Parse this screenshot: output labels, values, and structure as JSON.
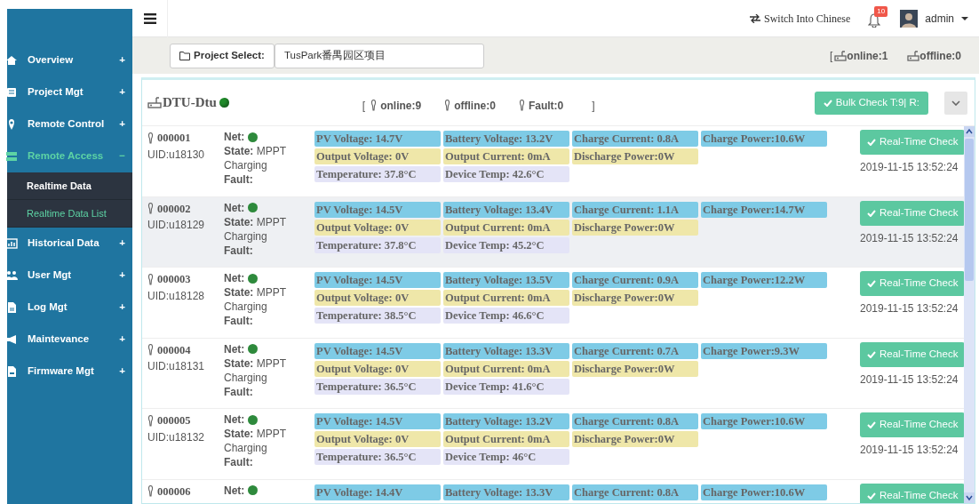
{
  "topbar": {
    "language_link": "Switch Into Chinese",
    "notification_count": "10",
    "user": "admin"
  },
  "sidebar": {
    "items": [
      {
        "label": "Overview",
        "sign": "+",
        "expanded": false
      },
      {
        "label": "Project Mgt",
        "sign": "+",
        "expanded": false
      },
      {
        "label": "Remote Control",
        "sign": "+",
        "expanded": false
      },
      {
        "label": "Remote Access",
        "sign": "−",
        "expanded": true,
        "children": [
          {
            "label": "Realtime Data",
            "selected": false
          },
          {
            "label": "Realtime Data List",
            "selected": true
          }
        ]
      },
      {
        "label": "Historical Data",
        "sign": "+",
        "expanded": false
      },
      {
        "label": "User Mgt",
        "sign": "+",
        "expanded": false
      },
      {
        "label": "Log Mgt",
        "sign": "+",
        "expanded": false
      },
      {
        "label": "Maintevance",
        "sign": "+",
        "expanded": false
      },
      {
        "label": "Firmware Mgt",
        "sign": "+",
        "expanded": false
      }
    ]
  },
  "project_bar": {
    "button": "Project Select:",
    "value": "TusPark番禺园区项目",
    "open_bracket": "[",
    "online": "online:1",
    "offline": "offline:0"
  },
  "panel": {
    "title": "DTU-Dtu",
    "online": true,
    "open_bracket": "[",
    "online_count": "online:9",
    "offline_count": "offline:0",
    "fault_count": "Fault:0",
    "close_bracket": "]",
    "bulk_button": "Bulk Check T:9| R:"
  },
  "devices": [
    {
      "id": "000001",
      "uid": "UID:u18130",
      "net_label": "Net:",
      "online": true,
      "state_label": "State:",
      "state": "MPPT Charging",
      "fault_label": "Fault:",
      "highlighted": false,
      "lines": [
        [
          {
            "kind": "input",
            "text": "PV Voltage: 14.7V"
          },
          {
            "kind": "input",
            "text": "Battery Voltage: 13.2V"
          },
          {
            "kind": "input",
            "text": "Charge Current: 0.8A"
          },
          {
            "kind": "input",
            "text": "Charge Power:10.6W"
          }
        ],
        [
          {
            "kind": "output",
            "text": "Output Voltage: 0V"
          },
          {
            "kind": "output",
            "text": "Output Current: 0mA"
          },
          {
            "kind": "output",
            "text": "Discharge Power:0W"
          }
        ],
        [
          {
            "kind": "temp",
            "text": "Temperature: 37.8°C"
          },
          {
            "kind": "temp",
            "text": "Device Temp: 42.6°C"
          }
        ]
      ],
      "button": "Real-Time Check",
      "time": "2019-11-15 13:52:24"
    },
    {
      "id": "000002",
      "uid": "UID:u18129",
      "net_label": "Net:",
      "online": true,
      "state_label": "State:",
      "state": "MPPT Charging",
      "fault_label": "Fault:",
      "highlighted": true,
      "lines": [
        [
          {
            "kind": "input",
            "text": "PV Voltage: 14.5V"
          },
          {
            "kind": "input",
            "text": "Battery Voltage: 13.4V"
          },
          {
            "kind": "input",
            "text": "Charge Current: 1.1A"
          },
          {
            "kind": "input",
            "text": "Charge Power:14.7W"
          }
        ],
        [
          {
            "kind": "output",
            "text": "Output Voltage: 0V"
          },
          {
            "kind": "output",
            "text": "Output Current: 0mA"
          },
          {
            "kind": "output",
            "text": "Discharge Power:0W"
          }
        ],
        [
          {
            "kind": "temp",
            "text": "Temperature: 37.8°C"
          },
          {
            "kind": "temp",
            "text": "Device Temp: 45.2°C"
          }
        ]
      ],
      "button": "Real-Time Check",
      "time": "2019-11-15 13:52:24"
    },
    {
      "id": "000003",
      "uid": "UID:u18128",
      "net_label": "Net:",
      "online": true,
      "state_label": "State:",
      "state": "MPPT Charging",
      "fault_label": "Fault:",
      "highlighted": false,
      "lines": [
        [
          {
            "kind": "input",
            "text": "PV Voltage: 14.5V"
          },
          {
            "kind": "input",
            "text": "Battery Voltage: 13.5V"
          },
          {
            "kind": "input",
            "text": "Charge Current: 0.9A"
          },
          {
            "kind": "input",
            "text": "Charge Power:12.2W"
          }
        ],
        [
          {
            "kind": "output",
            "text": "Output Voltage: 0V"
          },
          {
            "kind": "output",
            "text": "Output Current: 0mA"
          },
          {
            "kind": "output",
            "text": "Discharge Power:0W"
          }
        ],
        [
          {
            "kind": "temp",
            "text": "Temperature: 38.5°C"
          },
          {
            "kind": "temp",
            "text": "Device Temp: 46.6°C"
          }
        ]
      ],
      "button": "Real-Time Check",
      "time": "2019-11-15 13:52:24"
    },
    {
      "id": "000004",
      "uid": "UID:u18131",
      "net_label": "Net:",
      "online": true,
      "state_label": "State:",
      "state": "MPPT Charging",
      "fault_label": "Fault:",
      "highlighted": false,
      "lines": [
        [
          {
            "kind": "input",
            "text": "PV Voltage: 14.5V"
          },
          {
            "kind": "input",
            "text": "Battery Voltage: 13.3V"
          },
          {
            "kind": "input",
            "text": "Charge Current: 0.7A"
          },
          {
            "kind": "input",
            "text": "Charge Power:9.3W"
          }
        ],
        [
          {
            "kind": "output",
            "text": "Output Voltage: 0V"
          },
          {
            "kind": "output",
            "text": "Output Current: 0mA"
          },
          {
            "kind": "output",
            "text": "Discharge Power:0W"
          }
        ],
        [
          {
            "kind": "temp",
            "text": "Temperature: 36.5°C"
          },
          {
            "kind": "temp",
            "text": "Device Temp: 41.6°C"
          }
        ]
      ],
      "button": "Real-Time Check",
      "time": "2019-11-15 13:52:24"
    },
    {
      "id": "000005",
      "uid": "UID:u18132",
      "net_label": "Net:",
      "online": true,
      "state_label": "State:",
      "state": "MPPT Charging",
      "fault_label": "Fault:",
      "highlighted": false,
      "lines": [
        [
          {
            "kind": "input",
            "text": "PV Voltage: 14.5V"
          },
          {
            "kind": "input",
            "text": "Battery Voltage: 13.2V"
          },
          {
            "kind": "input",
            "text": "Charge Current: 0.8A"
          },
          {
            "kind": "input",
            "text": "Charge Power:10.6W"
          }
        ],
        [
          {
            "kind": "output",
            "text": "Output Voltage: 0V"
          },
          {
            "kind": "output",
            "text": "Output Current: 0mA"
          },
          {
            "kind": "output",
            "text": "Discharge Power:0W"
          }
        ],
        [
          {
            "kind": "temp",
            "text": "Temperature: 36.5°C"
          },
          {
            "kind": "temp",
            "text": "Device Temp: 46°C"
          }
        ]
      ],
      "button": "Real-Time Check",
      "time": "2019-11-15 13:52:24"
    },
    {
      "id": "000006",
      "net_label": "Net:",
      "online": true,
      "highlighted": false,
      "lines": [
        [
          {
            "kind": "input",
            "text": "PV Voltage: 14.4V"
          },
          {
            "kind": "input",
            "text": "Battery Voltage: 13.3V"
          },
          {
            "kind": "input",
            "text": "Charge Current: 0.8A"
          },
          {
            "kind": "input",
            "text": "Charge Power:10.6W"
          }
        ]
      ],
      "button": "Real-Time Check"
    }
  ]
}
